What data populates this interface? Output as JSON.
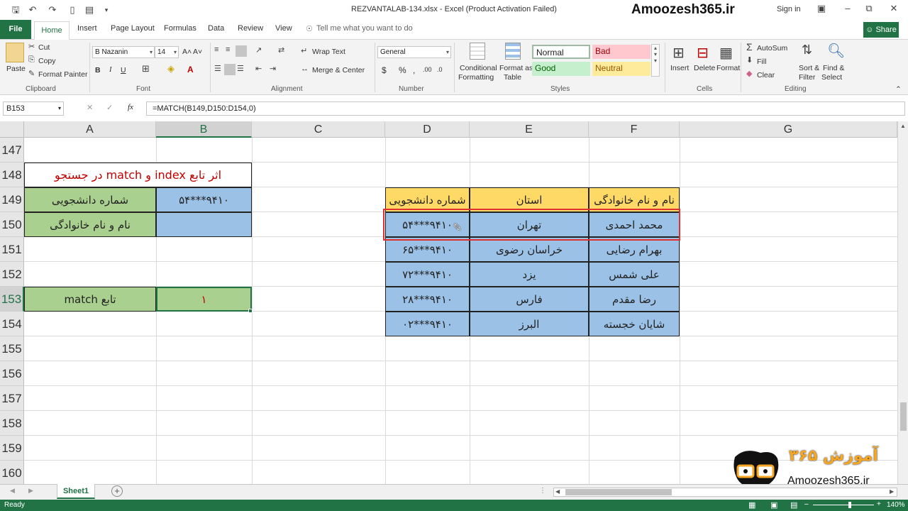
{
  "titlebar": {
    "doc_title": "REZVANTALAB-134.xlsx - Excel (Product Activation Failed)",
    "brand": "Amoozesh365.ir",
    "signin": "Sign in"
  },
  "tabs": {
    "file": "File",
    "items": [
      "Home",
      "Insert",
      "Page Layout",
      "Formulas",
      "Data",
      "Review",
      "View"
    ],
    "tell_me": "Tell me what you want to do",
    "share": "Share"
  },
  "ribbon": {
    "clipboard": {
      "paste": "Paste",
      "cut": "Cut",
      "copy": "Copy",
      "format_painter": "Format Painter",
      "label": "Clipboard"
    },
    "font": {
      "name": "B Nazanin",
      "size": "14",
      "label": "Font"
    },
    "alignment": {
      "wrap": "Wrap Text",
      "merge": "Merge & Center",
      "label": "Alignment"
    },
    "number": {
      "format": "General",
      "label": "Number"
    },
    "styles": {
      "conditional": "Conditional",
      "formatting": "Formatting",
      "format_as": "Format as",
      "table": "Table",
      "normal": "Normal",
      "bad": "Bad",
      "good": "Good",
      "neutral": "Neutral",
      "label": "Styles"
    },
    "cells": {
      "insert": "Insert",
      "delete": "Delete",
      "format": "Format",
      "label": "Cells"
    },
    "editing": {
      "autosum": "AutoSum",
      "fill": "Fill",
      "clear": "Clear",
      "sort1": "Sort &",
      "sort2": "Filter",
      "find1": "Find &",
      "find2": "Select",
      "label": "Editing"
    }
  },
  "formula_bar": {
    "name_box": "B153",
    "formula": "=MATCH(B149,D150:D154,0)"
  },
  "columns": [
    "A",
    "B",
    "C",
    "D",
    "E",
    "F",
    "G"
  ],
  "rows": [
    "147",
    "148",
    "149",
    "150",
    "151",
    "152",
    "153",
    "154",
    "155",
    "156",
    "157",
    "158",
    "159",
    "160"
  ],
  "cells": {
    "a148_title": "اثر تابع index و match در جستجو",
    "a149": "شماره دانشجویی",
    "b149": "۹۴۱۰***۵۴",
    "a150": "نام و نام خانوادگی",
    "a153": "تابع match",
    "b153": "۱"
  },
  "table": {
    "headers": [
      "شماره دانشجویی",
      "استان",
      "نام و نام خانوادگی"
    ],
    "rows": [
      [
        "۹۴۱۰***۵۴",
        "تهران",
        "محمد احمدی"
      ],
      [
        "۹۴۱۰***۶۵",
        "خراسان رضوی",
        "بهرام رضایی"
      ],
      [
        "۹۴۱۰***۷۲",
        "یزد",
        "علی شمس"
      ],
      [
        "۹۴۱۰***۲۸",
        "فارس",
        "رضا مقدم"
      ],
      [
        "۹۴۱۰***۰۲",
        "البرز",
        "شایان خجسته"
      ]
    ]
  },
  "sheet": {
    "tab": "Sheet1"
  },
  "status": {
    "ready": "Ready",
    "zoom": "140%"
  },
  "watermark": {
    "text": "Amoozesh365.ir",
    "persian": "آموزش ۳۶۵"
  },
  "colors": {
    "excel_green": "#217346",
    "cell_green": "#a9d08e",
    "cell_blue": "#9bc2e6",
    "header_yellow": "#ffd966",
    "highlight_red": "#e03030"
  }
}
